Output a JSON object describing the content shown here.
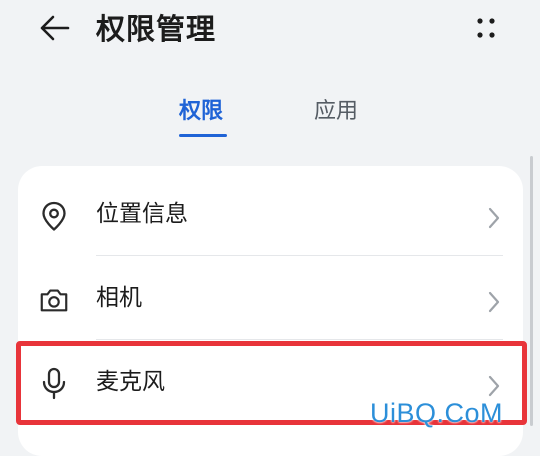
{
  "header": {
    "back_icon": "arrow-left-icon",
    "title": "权限管理",
    "more_icon": "more-dots-icon"
  },
  "tabs": [
    {
      "label": "权限",
      "active": true
    },
    {
      "label": "应用",
      "active": false
    }
  ],
  "colors": {
    "accent": "#1f63d6",
    "highlight": "#e8343a",
    "watermark": "#2c8fd9"
  },
  "permissions": [
    {
      "label": "位置信息",
      "icon": "location-pin-icon"
    },
    {
      "label": "相机",
      "icon": "camera-icon"
    },
    {
      "label": "麦克风",
      "icon": "microphone-icon"
    }
  ],
  "watermark": "UiBQ.CoM"
}
